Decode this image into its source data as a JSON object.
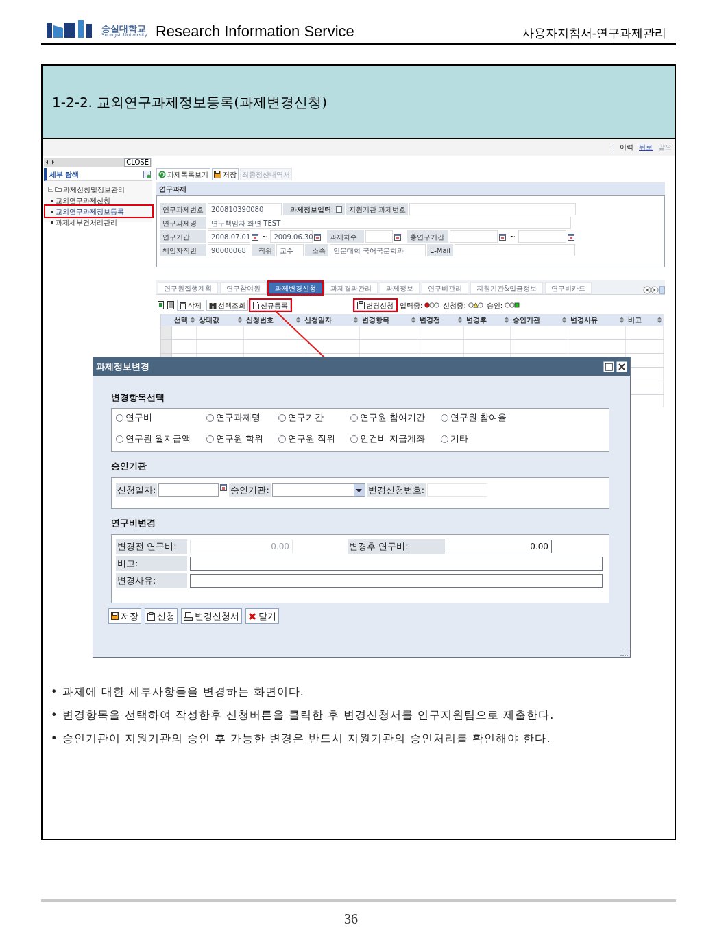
{
  "header": {
    "logo_name": "숭실대학교",
    "logo_subtitle": "Soongsil University",
    "title": "Research Information Service",
    "doc_title": "사용자지침서-연구과제관리"
  },
  "section_title": "1-2-2. 교외연구과제정보등록(과제변경신청)",
  "app": {
    "top_links": [
      {
        "label": "이력",
        "kind": "text"
      },
      {
        "label": "뒤로",
        "kind": "link"
      },
      {
        "label": "앞으",
        "kind": "disabled"
      }
    ],
    "sidebar": {
      "close_label": "CLOSE",
      "heading": "세부 탐색",
      "tree": [
        {
          "label": "과제신청및정보관리",
          "expanded": true,
          "children": [
            {
              "label": "교외연구과제신청",
              "selected": false,
              "annotated": false
            },
            {
              "label": "교외연구과제정보등록",
              "selected": true,
              "annotated": true
            },
            {
              "label": "과제세부건처리관리",
              "selected": false,
              "annotated": false
            }
          ]
        }
      ]
    },
    "toolbar": [
      {
        "label": "과제목록보기",
        "kind": "refresh",
        "disabled": false
      },
      {
        "label": "저장",
        "kind": "save",
        "disabled": false
      },
      {
        "label": "최종정산내역서",
        "kind": "plain",
        "disabled": true
      }
    ],
    "section": "연구과제",
    "form": {
      "project_no_label": "연구과제번호",
      "project_no": "200810390080",
      "info_input_label": "과제정보입력:",
      "info_input_checked": false,
      "agency_no_label": "지원기관 과제번호",
      "project_name_label": "연구과제명",
      "project_name": "연구책임자 화면 TEST",
      "period_label": "연구기간",
      "period_from": "2008.07.01",
      "period_sep": "~",
      "period_to": "2009.06.30",
      "round_label": "과제차수",
      "total_period_label": "총연구기간",
      "total_period_sep": "~",
      "emp_no_label": "책임자직번",
      "emp_no": "90000068",
      "position_label": "직위",
      "position": "교수",
      "dept_label": "소속",
      "dept": "인문대학 국어국문학과",
      "email_label": "E-Mail"
    },
    "tabs": [
      {
        "label": "연구원집행계획",
        "selected": false,
        "annotated": false
      },
      {
        "label": "연구참여원",
        "selected": false,
        "annotated": false
      },
      {
        "label": "과제변경신청",
        "selected": true,
        "annotated": true
      },
      {
        "label": "과제결과관리",
        "selected": false,
        "annotated": false
      },
      {
        "label": "과제정보",
        "selected": false,
        "annotated": false
      },
      {
        "label": "연구비관리",
        "selected": false,
        "annotated": false
      },
      {
        "label": "지원기관&입금정보",
        "selected": false,
        "annotated": false
      },
      {
        "label": "연구비카드",
        "selected": false,
        "annotated": false
      }
    ],
    "grid_buttons": [
      {
        "label": "삭제",
        "kind": "delete",
        "annotated": false
      },
      {
        "label": "선택조회",
        "kind": "query",
        "annotated": false
      },
      {
        "label": "신규등록",
        "kind": "new",
        "annotated": true
      },
      {
        "label": "변경신청",
        "kind": "apply",
        "annotated": true
      }
    ],
    "legend": [
      {
        "label": "입력중:",
        "kind": "input"
      },
      {
        "label": "신청중:",
        "kind": "request"
      },
      {
        "label": "승인:",
        "kind": "approved"
      }
    ],
    "columns": [
      "선택",
      "상태값",
      "신청번호",
      "신청일자",
      "변경항목",
      "변경전",
      "변경후",
      "승인기관",
      "변경사유",
      "비고"
    ]
  },
  "dialog": {
    "title": "과제정보변경",
    "change_items": {
      "heading": "변경항목선택",
      "options": [
        {
          "label": "연구비",
          "selected": false
        },
        {
          "label": "연구과제명",
          "selected": false
        },
        {
          "label": "연구기간",
          "selected": false
        },
        {
          "label": "연구원 참여기간",
          "selected": false
        },
        {
          "label": "연구원 참여율",
          "selected": false
        },
        {
          "label": "연구원 월지급액",
          "selected": false
        },
        {
          "label": "연구원 학위",
          "selected": false
        },
        {
          "label": "연구원 직위",
          "selected": false
        },
        {
          "label": "인건비 지급계좌",
          "selected": false
        },
        {
          "label": "기타",
          "selected": false
        }
      ]
    },
    "approval": {
      "heading": "승인기관",
      "date_label": "신청일자:",
      "agency_label": "승인기관:",
      "request_no_label": "변경신청번호:"
    },
    "budget": {
      "heading": "연구비변경",
      "before_label": "변경전 연구비:",
      "before_value": "0.00",
      "after_label": "변경후 연구비:",
      "after_value": "0.00",
      "note_label": "비고:",
      "reason_label": "변경사유:"
    },
    "buttons": [
      {
        "label": "저장",
        "kind": "save"
      },
      {
        "label": "신청",
        "kind": "apply"
      },
      {
        "label": "변경신청서",
        "kind": "form"
      },
      {
        "label": "닫기",
        "kind": "close"
      }
    ]
  },
  "notes": [
    "• 과제에 대한 세부사항들을 변경하는 화면이다.",
    "• 변경항목을 선택하여 작성한후 신청버튼을 클릭한 후 변경신청서를 연구지원팀으로 제출한다.",
    "• 승인기관이 지원기관의 승인 후 가능한 변경은 반드시 지원기관의 승인처리를 확인해야 한다."
  ],
  "page_number": "36"
}
